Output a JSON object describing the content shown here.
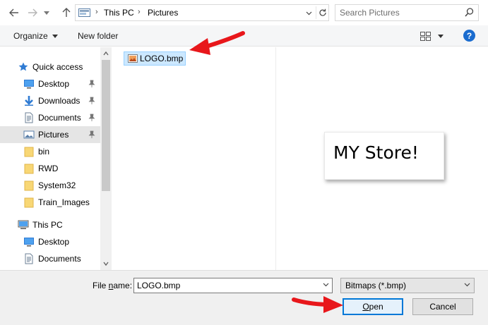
{
  "window": {
    "address": {
      "crumbs": [
        "This PC",
        "Pictures"
      ],
      "separator": "›"
    },
    "search": {
      "placeholder": "Search Pictures"
    }
  },
  "commandbar": {
    "organize_label": "Organize",
    "new_folder_label": "New folder",
    "help_label": "?"
  },
  "navigation": {
    "items": [
      {
        "label": "Quick access",
        "icon": "star-icon",
        "pinned": false
      },
      {
        "label": "Desktop",
        "icon": "desktop-icon",
        "pinned": true
      },
      {
        "label": "Downloads",
        "icon": "download-icon",
        "pinned": true
      },
      {
        "label": "Documents",
        "icon": "documents-icon",
        "pinned": true
      },
      {
        "label": "Pictures",
        "icon": "pictures-icon",
        "pinned": true,
        "selected": true
      },
      {
        "label": "bin",
        "icon": "folder-icon",
        "pinned": false
      },
      {
        "label": "RWD",
        "icon": "folder-icon",
        "pinned": false
      },
      {
        "label": "System32",
        "icon": "folder-icon",
        "pinned": false
      },
      {
        "label": "Train_Images",
        "icon": "folder-icon",
        "pinned": false
      },
      {
        "label": "This PC",
        "icon": "computer-icon",
        "pinned": false
      },
      {
        "label": "Desktop",
        "icon": "desktop-icon",
        "pinned": false
      },
      {
        "label": "Documents",
        "icon": "documents-icon",
        "pinned": false
      }
    ]
  },
  "files": [
    {
      "name": "LOGO.bmp",
      "icon": "bitmap-file-icon",
      "selected": true
    }
  ],
  "preview": {
    "text": "MY Store!"
  },
  "bottom": {
    "file_name_label_prefix": "File ",
    "file_name_label_accel": "n",
    "file_name_label_suffix": "ame:",
    "file_name_value": "LOGO.bmp",
    "file_type_value": "Bitmaps (*.bmp)",
    "open_label_accel": "O",
    "open_label_rest": "pen",
    "cancel_label": "Cancel"
  },
  "colors": {
    "accent": "#0078d7",
    "selection": "#cce8ff",
    "annotation_arrow": "#e8171b",
    "help": "#1a6ccf"
  }
}
